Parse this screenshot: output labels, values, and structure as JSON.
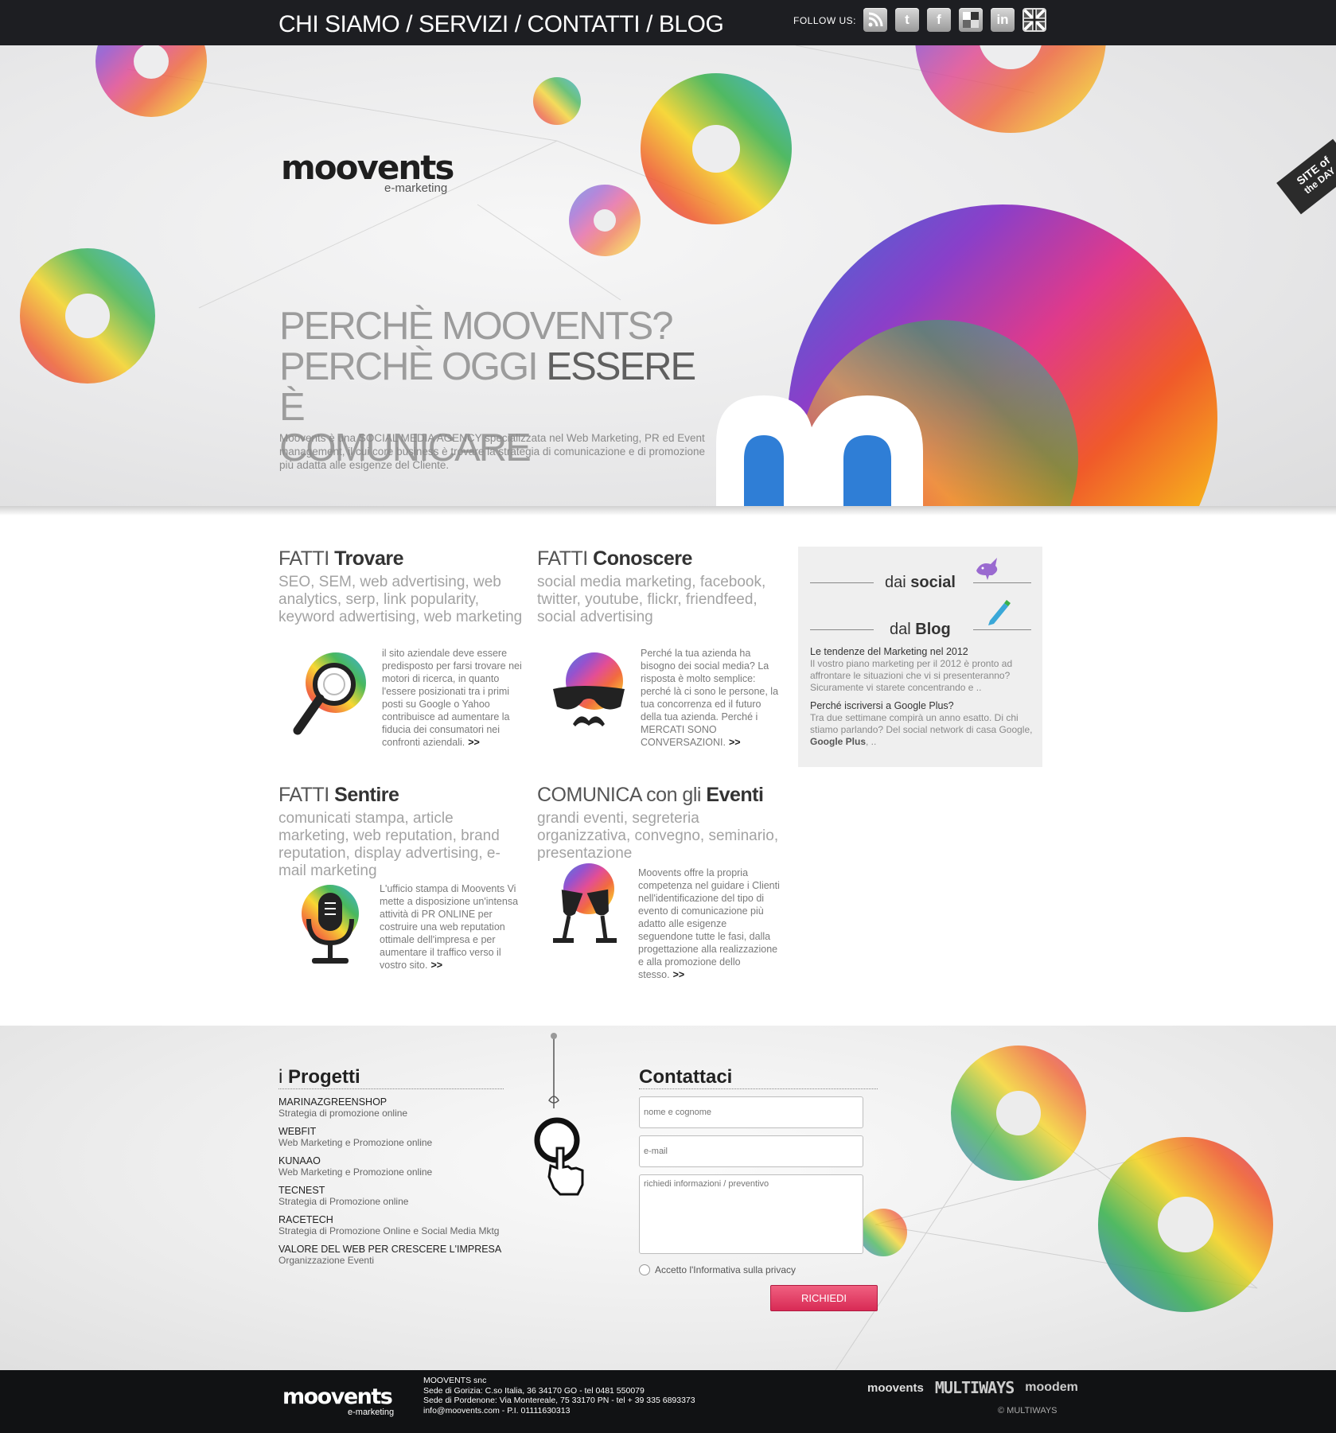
{
  "nav": {
    "items": [
      "CHI SIAMO",
      "SERVIZI",
      "CONTATTI",
      "BLOG"
    ],
    "separator": "/"
  },
  "follow": {
    "label": "FOLLOW US:",
    "icons": [
      "rss-icon",
      "twitter-icon",
      "facebook-icon",
      "delicious-icon",
      "linkedin-icon",
      "uk-flag-icon"
    ]
  },
  "brand": {
    "name": "moovents",
    "tagline": "e-marketing"
  },
  "badge": {
    "line1": "SITE of",
    "line2": "the DAY"
  },
  "hero": {
    "line1": "PERCHÈ MOOVENTS?",
    "line2a": "PERCHÈ OGGI ",
    "line2b": "ESSERE",
    "line2c": " È",
    "line3": "COMUNICARE",
    "desc": "Moovents è una SOCIAL MEDIA AGENCY specializzata nel Web Marketing, PR ed Event management, il cui core business è trovare la strategia di comunicazione e di promozione più adatta alle esigenze del Cliente."
  },
  "services": [
    {
      "pre": "FATTI ",
      "bold": "Trovare",
      "keywords": "SEO, SEM, web advertising, web analytics, serp, link popularity, keyword adwertising, web marketing",
      "body": "il sito aziendale deve essere predisposto per farsi trovare nei motori di ricerca, in quanto l'essere posizionati tra i primi posti su Google o Yahoo contribuisce ad aumentare la fiducia dei consumatori nei confronti aziendali.",
      "more": ">>"
    },
    {
      "pre": "FATTI ",
      "bold": "Conoscere",
      "keywords": "social media marketing, facebook, twitter, youtube, flickr, friendfeed, social advertising",
      "body": "Perché la tua azienda ha bisogno dei social media? La risposta è molto semplice: perché là ci sono le persone, la tua concorrenza ed il futuro della tua azienda. Perché i MERCATI SONO CONVERSAZIONI.",
      "more": ">>"
    },
    {
      "pre": "FATTI ",
      "bold": "Sentire",
      "keywords": "comunicati stampa, article marketing, web reputation, brand reputation, display advertising, e-mail marketing",
      "body": "L'ufficio stampa di Moovents Vi mette a disposizione un'intensa attività di PR ONLINE per costruire una web reputation ottimale dell'impresa e per aumentare il traffico verso il vostro sito.",
      "more": ">>"
    },
    {
      "pre": "COMUNICA con gli ",
      "bold": "Eventi",
      "keywords": "grandi eventi, segreteria organizzativa, convegno, seminario, presentazione",
      "body": "Moovents offre la propria competenza nel guidare i Clienti nell'identificazione del tipo di evento di comunicazione più adatto alle esigenze seguendone tutte le fasi, dalla progettazione alla realizzazione e alla promozione dello stesso.",
      "more": ">>"
    }
  ],
  "sidebar": {
    "social_pre": "dai ",
    "social_bold": "social",
    "blog_pre": "dal ",
    "blog_bold": "Blog",
    "posts": [
      {
        "title": "Le tendenze del Marketing nel 2012",
        "excerpt": "Il vostro piano marketing per il 2012 è pronto ad affrontare le situazioni che vi si presenteranno? Sicuramente vi starete concentrando e .."
      },
      {
        "title": "Perché iscriversi a Google Plus?",
        "excerpt_pre": "Tra due settimane compirà un anno esatto. Di chi stiamo parlando? Del social network di casa Google, ",
        "excerpt_bold": "Google Plus",
        "excerpt_post": ", .."
      }
    ]
  },
  "projects": {
    "title_pre": "i ",
    "title_bold": "Progetti",
    "items": [
      {
        "name": "MARINAZGREENSHOP",
        "desc": "Strategia di promozione online"
      },
      {
        "name": "WEBFIT",
        "desc": "Web Marketing e Promozione online"
      },
      {
        "name": "KUNAAO",
        "desc": "Web Marketing e Promozione online"
      },
      {
        "name": "TECNEST",
        "desc": "Strategia di Promozione online"
      },
      {
        "name": "RACETECH",
        "desc": "Strategia di Promozione Online e Social Media Mktg"
      },
      {
        "name": "VALORE DEL WEB PER CRESCERE L'IMPRESA",
        "desc": "Organizzazione Eventi"
      }
    ]
  },
  "contact": {
    "title": "Contattaci",
    "name_placeholder": "nome e cognome",
    "email_placeholder": "e-mail",
    "message_placeholder": "richiedi informazioni / preventivo",
    "privacy": "Accetto l'Informativa sulla privacy",
    "submit": "RICHIEDI"
  },
  "footer": {
    "brand": "moovents",
    "tagline": "e-marketing",
    "company": "MOOVENTS snc",
    "line1": "Sede di Gorizia: C.so Italia, 36 34170 GO - tel 0481 550079",
    "line2": "Sede di Pordenone: Via Montereale, 75 33170 PN - tel + 39 335 6893373",
    "line3": "info@moovents.com - P.I. 01111630313",
    "partners": [
      "moovents",
      "MULTIWAYS",
      "moodem"
    ],
    "copyright": "© MULTIWAYS"
  },
  "colors": {
    "accent": "#e0305a",
    "dark": "#1d1e22",
    "footer": "#111214"
  }
}
